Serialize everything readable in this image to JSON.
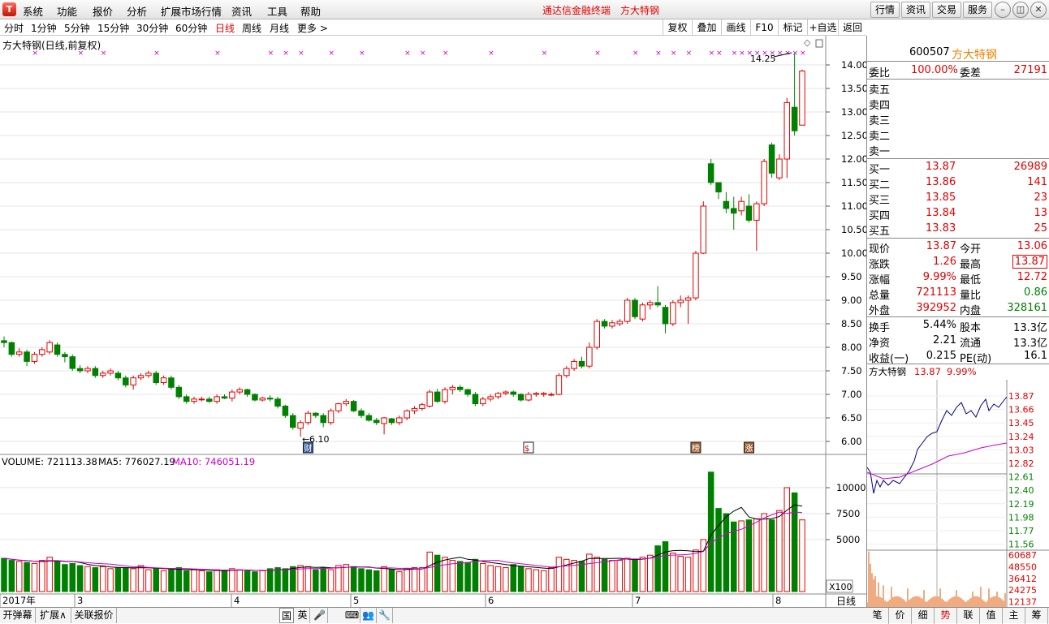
{
  "menu": {
    "logo": "T",
    "items": [
      "系统",
      "功能",
      "报价",
      "分析",
      "扩展市场行情",
      "资讯",
      "工具",
      "帮助"
    ],
    "terminal_name": "通达信金融终端",
    "stock_title": "方大特钢",
    "right_buttons": [
      "行情",
      "资讯",
      "交易",
      "服务"
    ]
  },
  "toolbar": {
    "periods": [
      "分时",
      "1分钟",
      "5分钟",
      "15分钟",
      "30分钟",
      "60分钟",
      "日线",
      "周线",
      "月线",
      "更多 >"
    ],
    "active_period": "日线",
    "tools": [
      "复权",
      "叠加",
      "画线",
      "F10",
      "标记",
      "+自选",
      "返回"
    ]
  },
  "chart": {
    "title": "方大特钢(日线,前复权)",
    "high_label": "14.25",
    "low_label": "6.10",
    "price_ticks": [
      "14.00",
      "13.50",
      "13.00",
      "12.50",
      "12.00",
      "11.50",
      "11.00",
      "10.50",
      "10.00",
      "9.50",
      "9.00",
      "8.50",
      "8.00",
      "7.50",
      "7.00",
      "6.50",
      "6.00"
    ],
    "events": [
      {
        "label": "财"
      },
      {
        "label": "$"
      },
      {
        "label": "榜"
      },
      {
        "label": "涨"
      }
    ],
    "volume_header": {
      "vol": "VOLUME: 721113.38",
      "ma5": "MA5: 776027.19",
      "ma10": "MA10: 746051.19"
    },
    "volume_ticks": [
      "10000",
      "7500",
      "5000"
    ],
    "volume_unit": "X100",
    "date_labels": [
      {
        "label": "2017年"
      },
      {
        "label": "3"
      },
      {
        "label": "4"
      },
      {
        "label": "5"
      },
      {
        "label": "6"
      },
      {
        "label": "7"
      },
      {
        "label": "8"
      }
    ],
    "axis_name": "日线",
    "colors": {
      "up": "#e00000",
      "down": "#008000",
      "ma5": "#000000",
      "ma10": "#cc00cc"
    }
  },
  "chart_data": {
    "type": "candlestick",
    "series_note": "daily OHLC",
    "ylim": [
      6.0,
      14.25
    ],
    "candles": [
      [
        8.14,
        8.23,
        8.0,
        8.1
      ],
      [
        8.1,
        8.12,
        7.8,
        7.85
      ],
      [
        7.85,
        7.98,
        7.8,
        7.9
      ],
      [
        7.9,
        7.95,
        7.6,
        7.7
      ],
      [
        7.7,
        7.9,
        7.65,
        7.85
      ],
      [
        7.85,
        8.0,
        7.8,
        7.95
      ],
      [
        7.9,
        8.15,
        7.85,
        8.1
      ],
      [
        8.05,
        8.1,
        7.8,
        7.85
      ],
      [
        7.85,
        7.9,
        7.68,
        7.8
      ],
      [
        7.8,
        7.85,
        7.5,
        7.55
      ],
      [
        7.55,
        7.62,
        7.45,
        7.5
      ],
      [
        7.5,
        7.6,
        7.45,
        7.55
      ],
      [
        7.55,
        7.6,
        7.35,
        7.4
      ],
      [
        7.4,
        7.5,
        7.35,
        7.45
      ],
      [
        7.45,
        7.55,
        7.4,
        7.5
      ],
      [
        7.45,
        7.5,
        7.3,
        7.35
      ],
      [
        7.35,
        7.4,
        7.15,
        7.2
      ],
      [
        7.2,
        7.4,
        7.1,
        7.35
      ],
      [
        7.35,
        7.45,
        7.3,
        7.4
      ],
      [
        7.4,
        7.5,
        7.35,
        7.45
      ],
      [
        7.45,
        7.5,
        7.2,
        7.25
      ],
      [
        7.25,
        7.4,
        7.2,
        7.35
      ],
      [
        7.35,
        7.4,
        7.1,
        7.15
      ],
      [
        7.15,
        7.2,
        6.9,
        6.95
      ],
      [
        6.95,
        7.0,
        6.8,
        6.85
      ],
      [
        6.85,
        6.95,
        6.8,
        6.9
      ],
      [
        6.9,
        6.95,
        6.85,
        6.9
      ],
      [
        6.9,
        6.95,
        6.82,
        6.85
      ],
      [
        6.85,
        7.0,
        6.8,
        6.95
      ],
      [
        6.95,
        7.0,
        6.9,
        6.92
      ],
      [
        6.92,
        7.1,
        6.85,
        7.05
      ],
      [
        7.05,
        7.15,
        7.0,
        7.1
      ],
      [
        7.1,
        7.12,
        6.95,
        7.0
      ],
      [
        7.0,
        7.02,
        6.85,
        6.88
      ],
      [
        6.88,
        6.95,
        6.85,
        6.92
      ],
      [
        6.92,
        6.98,
        6.85,
        6.9
      ],
      [
        6.9,
        6.95,
        6.7,
        6.75
      ],
      [
        6.75,
        6.78,
        6.5,
        6.55
      ],
      [
        6.55,
        6.6,
        6.25,
        6.3
      ],
      [
        6.28,
        6.45,
        6.1,
        6.4
      ],
      [
        6.4,
        6.65,
        6.35,
        6.6
      ],
      [
        6.6,
        6.62,
        6.5,
        6.55
      ],
      [
        6.55,
        6.6,
        6.3,
        6.4
      ],
      [
        6.4,
        6.7,
        6.35,
        6.65
      ],
      [
        6.65,
        6.82,
        6.6,
        6.8
      ],
      [
        6.8,
        6.9,
        6.75,
        6.85
      ],
      [
        6.85,
        6.88,
        6.62,
        6.65
      ],
      [
        6.65,
        6.7,
        6.5,
        6.55
      ],
      [
        6.55,
        6.6,
        6.42,
        6.45
      ],
      [
        6.45,
        6.5,
        6.35,
        6.4
      ],
      [
        6.38,
        6.52,
        6.15,
        6.5
      ],
      [
        6.48,
        6.5,
        6.35,
        6.4
      ],
      [
        6.4,
        6.55,
        6.35,
        6.5
      ],
      [
        6.5,
        6.68,
        6.45,
        6.65
      ],
      [
        6.65,
        6.75,
        6.58,
        6.7
      ],
      [
        6.7,
        6.82,
        6.65,
        6.78
      ],
      [
        6.75,
        7.1,
        6.72,
        7.05
      ],
      [
        7.05,
        7.12,
        6.82,
        6.85
      ],
      [
        6.85,
        7.15,
        6.8,
        7.1
      ],
      [
        7.1,
        7.2,
        7.0,
        7.15
      ],
      [
        7.15,
        7.2,
        7.05,
        7.1
      ],
      [
        7.1,
        7.12,
        6.95,
        7.0
      ],
      [
        7.0,
        7.05,
        6.75,
        6.8
      ],
      [
        6.8,
        6.95,
        6.75,
        6.9
      ],
      [
        6.9,
        7.0,
        6.85,
        6.95
      ],
      [
        6.95,
        7.05,
        6.9,
        7.02
      ],
      [
        7.02,
        7.08,
        6.98,
        7.05
      ],
      [
        7.05,
        7.08,
        6.95,
        7.0
      ],
      [
        7.0,
        7.02,
        6.85,
        6.88
      ],
      [
        6.88,
        7.05,
        6.85,
        7.0
      ],
      [
        7.0,
        7.05,
        6.95,
        7.02
      ],
      [
        7.0,
        7.05,
        6.95,
        7.02
      ],
      [
        7.0,
        7.04,
        6.96,
        7.0
      ],
      [
        7.0,
        7.45,
        6.98,
        7.4
      ],
      [
        7.4,
        7.6,
        7.35,
        7.55
      ],
      [
        7.55,
        7.75,
        7.5,
        7.7
      ],
      [
        7.7,
        7.8,
        7.55,
        7.6
      ],
      [
        7.6,
        8.1,
        7.55,
        8.0
      ],
      [
        8.0,
        8.6,
        7.95,
        8.55
      ],
      [
        8.55,
        8.6,
        8.4,
        8.45
      ],
      [
        8.45,
        8.58,
        8.4,
        8.52
      ],
      [
        8.5,
        8.6,
        8.45,
        8.55
      ],
      [
        8.55,
        9.05,
        8.5,
        9.0
      ],
      [
        9.0,
        9.05,
        8.6,
        8.65
      ],
      [
        8.6,
        8.95,
        8.55,
        8.9
      ],
      [
        8.9,
        9.0,
        8.8,
        8.95
      ],
      [
        8.95,
        9.3,
        8.85,
        8.9
      ],
      [
        8.85,
        8.9,
        8.3,
        8.5
      ],
      [
        8.5,
        9.0,
        8.45,
        8.95
      ],
      [
        8.95,
        9.1,
        8.85,
        9.0
      ],
      [
        9.0,
        9.1,
        8.5,
        9.05
      ],
      [
        9.05,
        10.05,
        9.0,
        10.0
      ],
      [
        10.0,
        11.1,
        9.98,
        11.0
      ],
      [
        11.9,
        12.0,
        11.45,
        11.5
      ],
      [
        11.5,
        11.45,
        11.15,
        11.3
      ],
      [
        11.1,
        11.3,
        10.85,
        10.95
      ],
      [
        10.95,
        11.2,
        10.5,
        10.85
      ],
      [
        10.9,
        11.2,
        10.8,
        11.1
      ],
      [
        11.0,
        11.25,
        10.65,
        10.7
      ],
      [
        10.7,
        11.1,
        10.05,
        11.05
      ],
      [
        11.05,
        12.0,
        11.0,
        11.95
      ],
      [
        12.3,
        12.35,
        11.6,
        11.7
      ],
      [
        11.6,
        12.1,
        11.55,
        12.0
      ],
      [
        12.0,
        13.3,
        11.6,
        13.2
      ],
      [
        13.1,
        14.25,
        12.5,
        12.6
      ],
      [
        12.72,
        13.9,
        12.72,
        13.87
      ]
    ],
    "volume_ma_note": "values in X100 lots",
    "volumes": [
      3200,
      3000,
      2900,
      2800,
      2700,
      3000,
      3300,
      2900,
      2600,
      2700,
      2500,
      2400,
      2300,
      2400,
      2200,
      2300,
      2300,
      2200,
      2500,
      2100,
      2200,
      2000,
      2100,
      2300,
      2000,
      2100,
      2000,
      1900,
      2100,
      2000,
      2200,
      2100,
      2000,
      1900,
      2000,
      2200,
      2300,
      2200,
      2400,
      2500,
      2400,
      2100,
      2300,
      2100,
      2500,
      2600,
      2400,
      2200,
      2100,
      2000,
      2400,
      2100,
      1900,
      2200,
      2300,
      2300,
      3800,
      3500,
      3300,
      3000,
      2900,
      2800,
      3100,
      2700,
      2500,
      2400,
      2300,
      2600,
      2400,
      2200,
      2100,
      2000,
      2300,
      3300,
      3100,
      3000,
      2900,
      3600,
      3300,
      3100,
      3000,
      3000,
      3200,
      3100,
      3300,
      3500,
      4400,
      4800,
      3700,
      3400,
      3300,
      4000,
      5000,
      11500,
      8000,
      7500,
      6700,
      6800,
      6900,
      7000,
      7500,
      6900,
      7800,
      10000,
      9500,
      6900
    ]
  },
  "panel": {
    "code": "600507",
    "name": "方大特钢",
    "weibi_label": "委比",
    "weibi": "100.00%",
    "weicha_label": "委差",
    "weicha": "27191",
    "sells": [
      {
        "label": "卖五"
      },
      {
        "label": "卖四"
      },
      {
        "label": "卖三"
      },
      {
        "label": "卖二"
      },
      {
        "label": "卖一"
      }
    ],
    "buys": [
      {
        "label": "买一",
        "price": "13.87",
        "vol": "26989"
      },
      {
        "label": "买二",
        "price": "13.86",
        "vol": "141"
      },
      {
        "label": "买三",
        "price": "13.85",
        "vol": "23"
      },
      {
        "label": "买四",
        "price": "13.84",
        "vol": "13"
      },
      {
        "label": "买五",
        "price": "13.83",
        "vol": "25"
      }
    ],
    "stats": [
      {
        "l1": "现价",
        "v1": "13.87",
        "l2": "今开",
        "v2": "13.06",
        "c1": "red",
        "c2": "red"
      },
      {
        "l1": "涨跌",
        "v1": "1.26",
        "l2": "最高",
        "v2": "13.87",
        "c1": "red",
        "c2": "red"
      },
      {
        "l1": "涨幅",
        "v1": "9.99%",
        "l2": "最低",
        "v2": "12.72",
        "c1": "red",
        "c2": "red"
      },
      {
        "l1": "总量",
        "v1": "721113",
        "l2": "量比",
        "v2": "0.86",
        "c1": "red",
        "c2": "green"
      },
      {
        "l1": "外盘",
        "v1": "392952",
        "l2": "内盘",
        "v2": "328161",
        "c1": "red",
        "c2": "green"
      }
    ],
    "stats2": [
      {
        "l1": "换手",
        "v1": "5.44%",
        "l2": "股本",
        "v2": "13.3亿"
      },
      {
        "l1": "净资",
        "v1": "2.21",
        "l2": "流通",
        "v2": "13.3亿"
      },
      {
        "l1": "收益(一)",
        "v1": "0.215",
        "l2": "PE(动)",
        "v2": "16.1"
      }
    ],
    "mini_title": "方大特钢",
    "mini_price": "13.87",
    "mini_pct": "9.99%",
    "mini_price_ticks": [
      "13.87",
      "13.66",
      "13.45",
      "13.24",
      "13.03",
      "12.82",
      "12.61",
      "12.40",
      "12.19",
      "11.98",
      "11.77",
      "11.56"
    ],
    "mini_vol_ticks": [
      "60687",
      "48550",
      "36412",
      "24275",
      "12137"
    ]
  },
  "bottom": {
    "buttons": [
      "开弹幕",
      "扩展∧",
      "关联报价"
    ],
    "icons": [
      "国",
      "英",
      "🎤",
      "⌨",
      "👥",
      "🔧"
    ]
  },
  "rp_tabs": [
    "笔",
    "价",
    "细",
    "势",
    "联",
    "值",
    "主",
    "筹"
  ],
  "rp_active": "势"
}
